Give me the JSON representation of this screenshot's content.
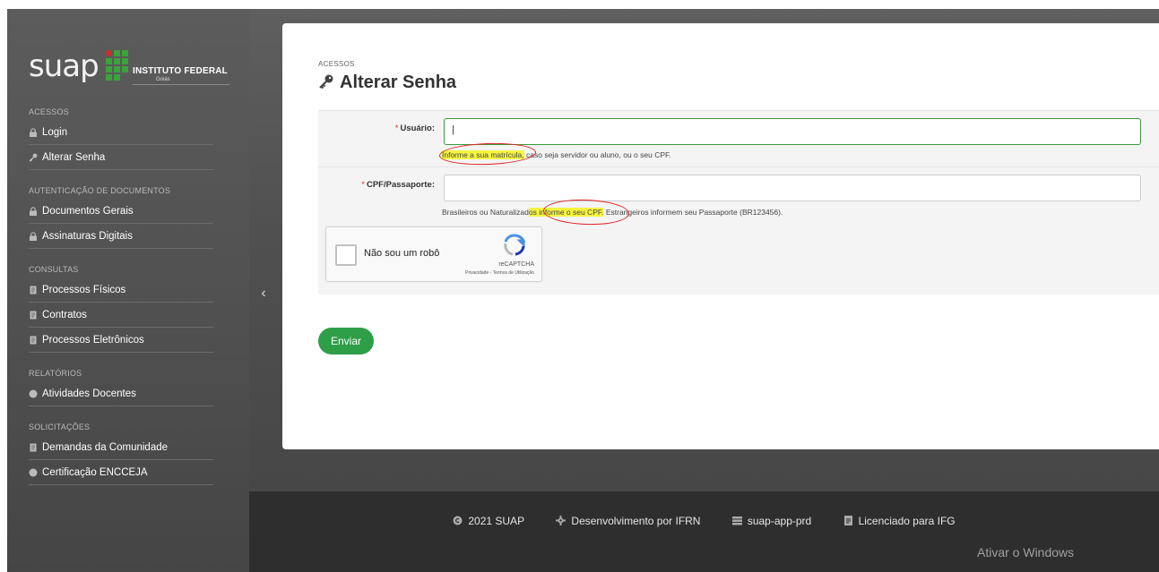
{
  "sidebar": {
    "brand": "suap",
    "institute": {
      "name": "INSTITUTO FEDERAL",
      "campus": "Goiás"
    },
    "sections": [
      {
        "title": "ACESSOS",
        "items": [
          {
            "label": "Login",
            "icon": "lock-icon"
          },
          {
            "label": "Alterar Senha",
            "icon": "key-icon"
          }
        ]
      },
      {
        "title": "AUTENTICAÇÃO DE DOCUMENTOS",
        "items": [
          {
            "label": "Documentos Gerais",
            "icon": "lock-icon"
          },
          {
            "label": "Assinaturas Digitais",
            "icon": "lock-icon"
          }
        ]
      },
      {
        "title": "CONSULTAS",
        "items": [
          {
            "label": "Processos Físicos",
            "icon": "document-icon"
          },
          {
            "label": "Contratos",
            "icon": "document-icon"
          },
          {
            "label": "Processos Eletrônicos",
            "icon": "document-icon"
          }
        ]
      },
      {
        "title": "RELATÓRIOS",
        "items": [
          {
            "label": "Atividades Docentes",
            "icon": "circle-icon"
          }
        ]
      },
      {
        "title": "SOLICITAÇÕES",
        "items": [
          {
            "label": "Demandas da Comunidade",
            "icon": "document-icon"
          },
          {
            "label": "Certificação ENCCEJA",
            "icon": "circle-icon"
          }
        ]
      }
    ],
    "collapse_glyph": "‹"
  },
  "main": {
    "breadcrumb": "ACESSOS",
    "title": "Alterar Senha",
    "form": {
      "usuario": {
        "required_mark": "*",
        "label": "Usuário:",
        "value": "|",
        "help_highlight": "Informe a sua matrícula,",
        "help_rest": " caso seja servidor ou aluno, ou o seu CPF."
      },
      "cpf": {
        "required_mark": "*",
        "label": "CPF/Passaporte:",
        "value": "",
        "help_pre": "Brasileiros ou Naturalizad",
        "help_highlight": "os informe o seu CPF.",
        "help_rest": " Estrangeiros informem seu Passaporte (BR123456)."
      },
      "recaptcha": {
        "label": "Não sou um robô",
        "brand": "reCAPTCHA",
        "terms": "Privacidade - Termos de Utilização"
      },
      "submit_label": "Enviar"
    }
  },
  "footer": {
    "items": [
      {
        "label": "2021 SUAP",
        "icon": "copyright-icon"
      },
      {
        "label": "Desenvolvimento por IFRN",
        "icon": "gear-icon"
      },
      {
        "label": "suap-app-prd",
        "icon": "server-icon"
      },
      {
        "label": "Licenciado para IFG",
        "icon": "license-icon"
      }
    ]
  },
  "watermark": {
    "title": "Ativar o Windows"
  },
  "colors": {
    "accent": "#2e9e48",
    "highlight": "#f5f540",
    "annotation": "#d22222",
    "sidebar_bg": "#555555",
    "footer_bg": "#2e2e2e"
  }
}
